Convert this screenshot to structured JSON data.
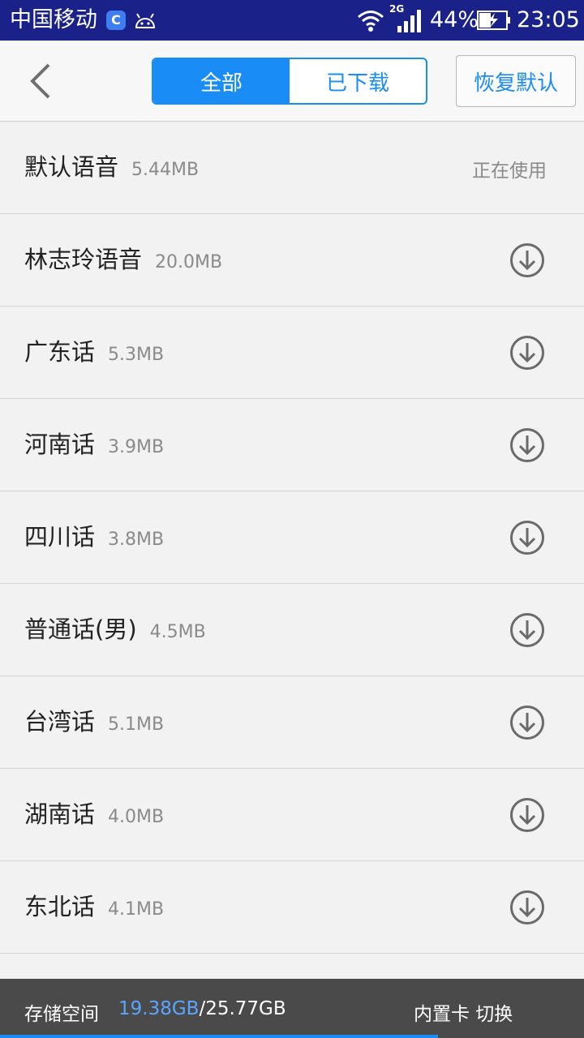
{
  "status_bar": {
    "carrier": "中国移动",
    "network_type": "2G",
    "battery_percent": "44%",
    "time": "23:05"
  },
  "header": {
    "tabs": [
      {
        "label": "全部",
        "active": true
      },
      {
        "label": "已下载",
        "active": false
      }
    ],
    "restore_label": "恢复默认"
  },
  "voices": [
    {
      "name": "默认语音",
      "size": "5.44MB",
      "status": "正在使用"
    },
    {
      "name": "林志玲语音",
      "size": "20.0MB",
      "status": ""
    },
    {
      "name": "广东话",
      "size": "5.3MB",
      "status": ""
    },
    {
      "name": "河南话",
      "size": "3.9MB",
      "status": ""
    },
    {
      "name": "四川话",
      "size": "3.8MB",
      "status": ""
    },
    {
      "name": "普通话(男)",
      "size": "4.5MB",
      "status": ""
    },
    {
      "name": "台湾话",
      "size": "5.1MB",
      "status": ""
    },
    {
      "name": "湖南话",
      "size": "4.0MB",
      "status": ""
    },
    {
      "name": "东北话",
      "size": "4.1MB",
      "status": ""
    }
  ],
  "footer": {
    "storage_label": "存储空间",
    "used": "19.38GB",
    "total": "/25.77GB",
    "switch_label": "内置卡  切换",
    "usage_fraction": 0.75
  },
  "colors": {
    "accent": "#1a8cf5",
    "status_bar": "#1a2188",
    "footer_bg": "#4a4a4a"
  }
}
